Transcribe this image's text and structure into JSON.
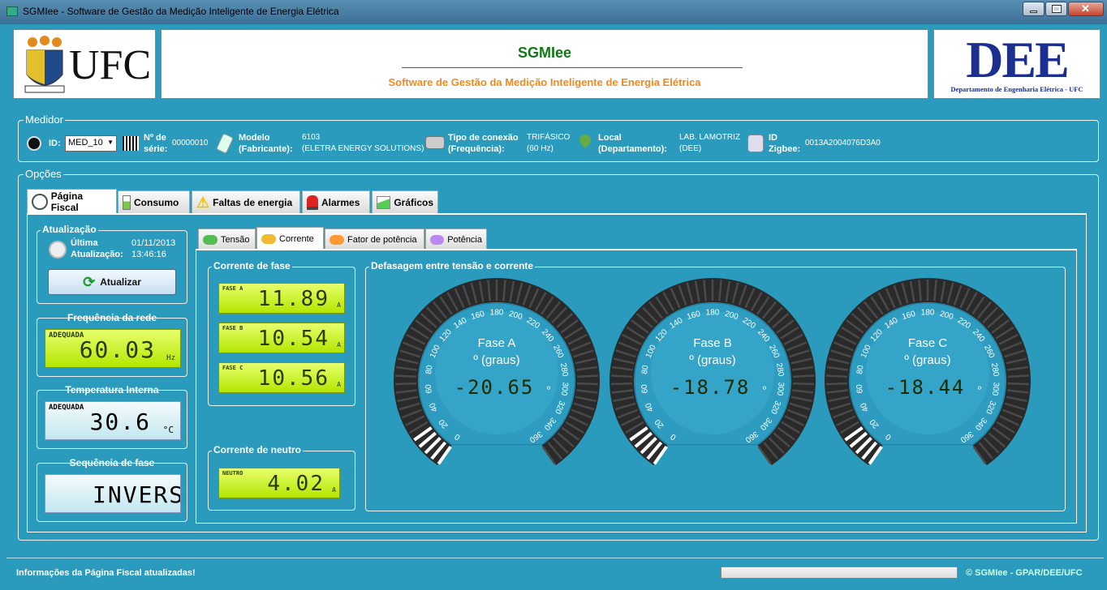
{
  "window": {
    "title": "SGMIee - Software de Gestão da Medição Inteligente de Energia Elétrica"
  },
  "header": {
    "left_logo": "UFC",
    "app_name": "SGMIee",
    "app_subtitle": "Software de Gestão da Medição Inteligente de Energia Elétrica",
    "right_logo": "DEE",
    "right_logo_caption": "Departamento de Engenharia Elétrica - UFC"
  },
  "medidor": {
    "legend": "Medidor",
    "id_label": "ID:",
    "id_value": "MED_10",
    "serie_label": "Nº de série:",
    "serie_value": "00000010",
    "modelo_label": "Modelo (Fabricante):",
    "modelo_value": "6103",
    "fabricante_value": "(ELETRA ENERGY SOLUTIONS)",
    "conexao_label": "Tipo de conexão (Frequência):",
    "conexao_value": "TRIFÁSICO",
    "frequencia_value": "(60 Hz)",
    "local_label": "Local (Departamento):",
    "local_value": "LAB. LAMOTRIZ",
    "departamento_value": "(DEE)",
    "zigbee_label": "ID Zigbee:",
    "zigbee_value": "0013A2004076D3A0"
  },
  "opcoes": {
    "legend": "Opções"
  },
  "tabs": [
    "Página Fiscal",
    "Consumo",
    "Faltas de energia",
    "Alarmes",
    "Gráficos"
  ],
  "subtabs": [
    "Tensão",
    "Corrente",
    "Fator de potência",
    "Potência"
  ],
  "atualizacao": {
    "legend": "Atualização",
    "label": "Última Atualização:",
    "date": "01/11/2013",
    "time": "13:46:16",
    "button": "Atualizar"
  },
  "frequencia": {
    "legend": "Frequência da rede",
    "status": "ADEQUADA",
    "value": "60.03",
    "unit": "Hz"
  },
  "temperatura": {
    "legend": "Temperatura Interna",
    "status": "ADEQUADA",
    "value": "30.6",
    "unit": "°C"
  },
  "sequencia": {
    "legend": "Sequência de fase",
    "value": "INVERSA"
  },
  "corrente_fase": {
    "legend": "Corrente de fase",
    "items": [
      {
        "tag": "FASE A",
        "value": "11.89",
        "unit": "A"
      },
      {
        "tag": "FASE B",
        "value": "10.54",
        "unit": "A"
      },
      {
        "tag": "FASE C",
        "value": "10.56",
        "unit": "A"
      }
    ]
  },
  "corrente_neutro": {
    "legend": "Corrente de neutro",
    "tag": "NEUTRO",
    "value": "4.02",
    "unit": "A"
  },
  "defasagem": {
    "legend": "Defasagem entre tensão e corrente",
    "scale": [
      "0",
      "20",
      "40",
      "60",
      "80",
      "100",
      "120",
      "140",
      "160",
      "180",
      "200",
      "220",
      "240",
      "260",
      "280",
      "300",
      "320",
      "340",
      "360"
    ],
    "unit_label": "º (graus)",
    "gauges": [
      {
        "name": "Fase A",
        "value": "-20.65",
        "unit": "º"
      },
      {
        "name": "Fase B",
        "value": "-18.78",
        "unit": "º"
      },
      {
        "name": "Fase C",
        "value": "-18.44",
        "unit": "º"
      }
    ]
  },
  "status": {
    "message": "Informações da Página Fiscal atualizadas!",
    "copyright": "© SGMIee - GPAR/DEE/UFC"
  }
}
